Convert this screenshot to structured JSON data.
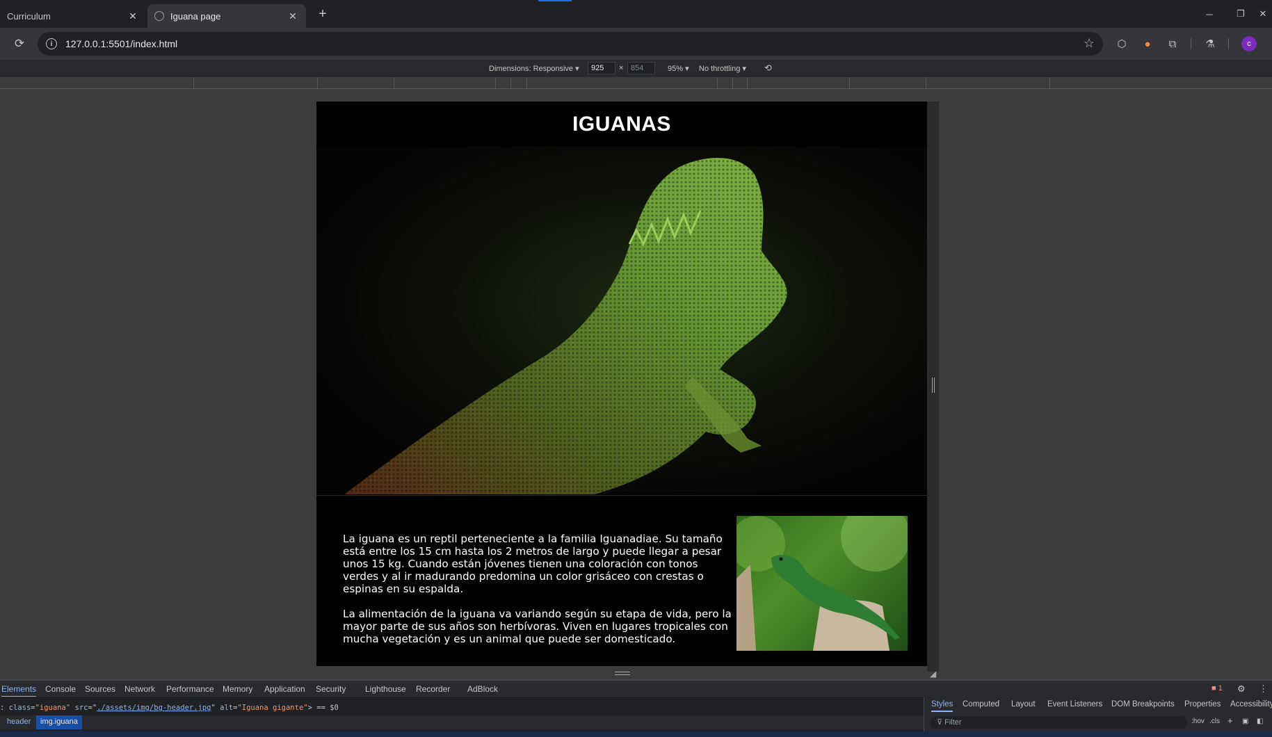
{
  "browser": {
    "tabs": [
      {
        "label": "Curriculum",
        "active": false
      },
      {
        "label": "Iguana page",
        "active": true
      }
    ],
    "new_tab_icon": "+",
    "window_controls": {
      "minimize": "─",
      "restore": "❐",
      "close": "✕"
    },
    "url": "127.0.0.1:5501/index.html",
    "profile_initial": "c"
  },
  "device_toolbar": {
    "dimensions_label": "Dimensions: Responsive ▾",
    "width": "925",
    "height": "854",
    "zoom": "95% ▾",
    "throttling": "No throttling ▾"
  },
  "page": {
    "title": "IGUANAS",
    "paragraphs": [
      "La iguana es un reptil perteneciente a la familia Iguanadiae. Su tamaño está entre los 15 cm hasta los 2 metros de largo y puede llegar a pesar unos 15 kg. Cuando están jóvenes tienen una coloración con tonos verdes y al ir madurando predomina un color grisáceo con crestas o espinas en su espalda.",
      "La alimentación de la iguana va variando según su etapa de vida, pero la mayor parte de sus años son herbívoras. Viven en lugares tropicales con mucha vegetación y es un animal que puede ser domesticado."
    ]
  },
  "devtools": {
    "tabs": [
      "Elements",
      "Console",
      "Sources",
      "Network",
      "Performance",
      "Memory",
      "Application",
      "Security",
      "Lighthouse",
      "Recorder",
      "AdBlock"
    ],
    "error_count": "1",
    "code": {
      "prefix": ": ",
      "class_attr": "class",
      "class_val": "\"iguana\"",
      "src_attr": "src",
      "src_val": "./assets/img/bg-header.jpg",
      "alt_attr": "alt",
      "alt_val": "\"Iguana gigante\"",
      "suffix": "> == $0"
    },
    "breadcrumbs": [
      "header",
      "img.iguana"
    ],
    "styles_tabs": [
      "Styles",
      "Computed",
      "Layout",
      "Event Listeners",
      "DOM Breakpoints",
      "Properties",
      "Accessibility"
    ],
    "filter_placeholder": "Filter",
    "hov_label": ":hov",
    "cls_label": ".cls"
  },
  "colors": {
    "page_bg": "#000000",
    "accent": "#8ab4f8",
    "iguana_green": "#6fa63a"
  }
}
